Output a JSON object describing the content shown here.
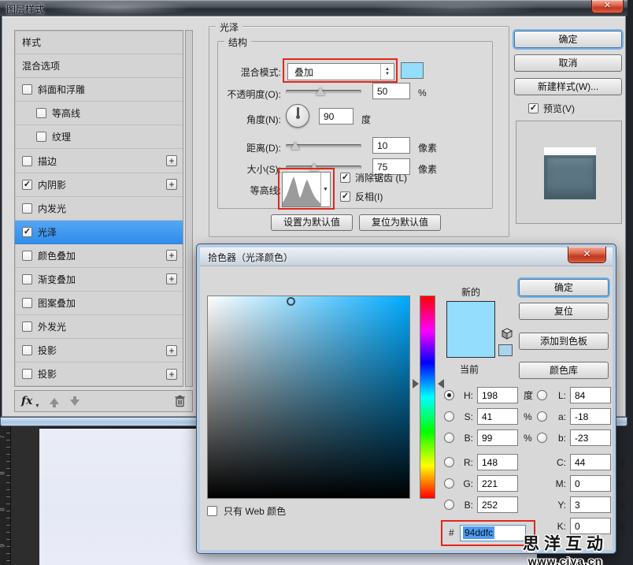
{
  "window": {
    "title": "图层样式"
  },
  "icons": {
    "close": "✕",
    "check": "✓",
    "plus": "+",
    "spin_up": "▲",
    "spin_down": "▼",
    "dropdown": "▼",
    "fx": "fx",
    "fx_caret": "▾",
    "hash": "#"
  },
  "colors": {
    "annotation_red": "#e0281e",
    "selection_blue": "#4d9bef",
    "satin": "#94ddfc",
    "hue_base": "#00aaff",
    "current_swatch": "#94ddfc",
    "mini_swatch": "#a9d4ef"
  },
  "sidebar": {
    "items": [
      {
        "label": "样式",
        "checkbox": false,
        "checked": false,
        "indent": false,
        "plus": false,
        "selected": false
      },
      {
        "label": "混合选项",
        "checkbox": false,
        "checked": false,
        "indent": false,
        "plus": false,
        "selected": false
      },
      {
        "label": "斜面和浮雕",
        "checkbox": true,
        "checked": false,
        "indent": false,
        "plus": false,
        "selected": false
      },
      {
        "label": "等高线",
        "checkbox": true,
        "checked": false,
        "indent": true,
        "plus": false,
        "selected": false
      },
      {
        "label": "纹理",
        "checkbox": true,
        "checked": false,
        "indent": true,
        "plus": false,
        "selected": false
      },
      {
        "label": "描边",
        "checkbox": true,
        "checked": false,
        "indent": false,
        "plus": true,
        "selected": false
      },
      {
        "label": "内阴影",
        "checkbox": true,
        "checked": true,
        "indent": false,
        "plus": true,
        "selected": false
      },
      {
        "label": "内发光",
        "checkbox": true,
        "checked": false,
        "indent": false,
        "plus": false,
        "selected": false
      },
      {
        "label": "光泽",
        "checkbox": true,
        "checked": true,
        "indent": false,
        "plus": false,
        "selected": true
      },
      {
        "label": "颜色叠加",
        "checkbox": true,
        "checked": false,
        "indent": false,
        "plus": true,
        "selected": false
      },
      {
        "label": "渐变叠加",
        "checkbox": true,
        "checked": false,
        "indent": false,
        "plus": true,
        "selected": false
      },
      {
        "label": "图案叠加",
        "checkbox": true,
        "checked": false,
        "indent": false,
        "plus": false,
        "selected": false
      },
      {
        "label": "外发光",
        "checkbox": true,
        "checked": false,
        "indent": false,
        "plus": false,
        "selected": false
      },
      {
        "label": "投影",
        "checkbox": true,
        "checked": false,
        "indent": false,
        "plus": true,
        "selected": false
      },
      {
        "label": "投影",
        "checkbox": true,
        "checked": false,
        "indent": false,
        "plus": true,
        "selected": false
      }
    ]
  },
  "panel": {
    "title": "光泽",
    "group": "结构",
    "blend_mode_label": "混合模式:",
    "blend_mode_value": "叠加",
    "opacity_label": "不透明度(O):",
    "opacity_value": "50",
    "opacity_unit": "%",
    "angle_label": "角度(N):",
    "angle_value": "90",
    "angle_unit": "度",
    "distance_label": "距离(D):",
    "distance_value": "10",
    "distance_unit": "像素",
    "size_label": "大小(S):",
    "size_value": "75",
    "size_unit": "像素",
    "contour_label": "等高线:",
    "antialias_label": "消除锯齿 (L)",
    "invert_label": "反相(I)",
    "set_default": "设置为默认值",
    "reset_default": "复位为默认值"
  },
  "actions": {
    "ok": "确定",
    "cancel": "取消",
    "new_style": "新建样式(W)...",
    "preview": "预览(V)"
  },
  "picker": {
    "title": "拾色器（光泽颜色）",
    "new_label": "新的",
    "current_label": "当前",
    "ok": "确定",
    "reset": "复位",
    "add_swatch": "添加到色板",
    "library": "颜色库",
    "web_only": "只有 Web 颜色",
    "hex_value": "94ddfc",
    "fields_left": [
      {
        "key": "H:",
        "value": "198",
        "unit": "度",
        "radio": true,
        "selected": true,
        "gap": false
      },
      {
        "key": "S:",
        "value": "41",
        "unit": "%",
        "radio": true,
        "selected": false,
        "gap": false
      },
      {
        "key": "B:",
        "value": "99",
        "unit": "%",
        "radio": true,
        "selected": false,
        "gap": false
      },
      {
        "key": "R:",
        "value": "148",
        "unit": "",
        "radio": true,
        "selected": false,
        "gap": true
      },
      {
        "key": "G:",
        "value": "221",
        "unit": "",
        "radio": true,
        "selected": false,
        "gap": false
      },
      {
        "key": "B:",
        "value": "252",
        "unit": "",
        "radio": true,
        "selected": false,
        "gap": false
      }
    ],
    "fields_right": [
      {
        "key": "L:",
        "value": "84",
        "unit": "",
        "radio": true,
        "selected": false,
        "gap": false
      },
      {
        "key": "a:",
        "value": "-18",
        "unit": "",
        "radio": true,
        "selected": false,
        "gap": false
      },
      {
        "key": "b:",
        "value": "-23",
        "unit": "",
        "radio": true,
        "selected": false,
        "gap": false
      },
      {
        "key": "C:",
        "value": "44",
        "unit": "%",
        "radio": false,
        "selected": false,
        "gap": true
      },
      {
        "key": "M:",
        "value": "0",
        "unit": "%",
        "radio": false,
        "selected": false,
        "gap": false
      },
      {
        "key": "Y:",
        "value": "3",
        "unit": "%",
        "radio": false,
        "selected": false,
        "gap": false
      },
      {
        "key": "K:",
        "value": "0",
        "unit": "%",
        "radio": false,
        "selected": false,
        "gap": false
      }
    ]
  },
  "watermark": {
    "line1": "思洋互动",
    "line2": "www.ciya.cn"
  },
  "ruler_marks": [
    "7",
    "8",
    "8",
    "9"
  ]
}
